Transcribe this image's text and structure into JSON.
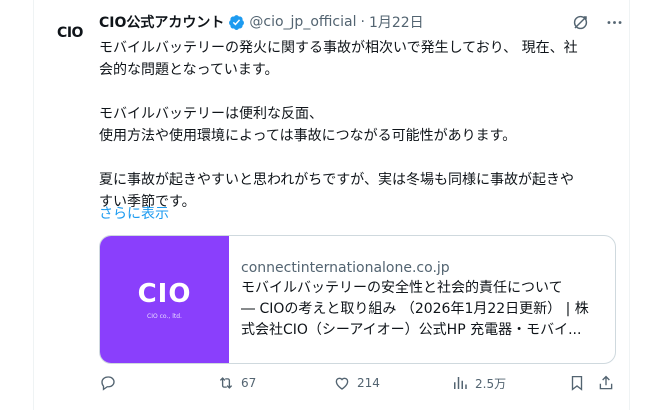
{
  "account": {
    "name": "CIO公式アカウント",
    "handle": "@cio_jp_official",
    "separator": "·",
    "date": "1月22日",
    "avatar_logo": "CIO"
  },
  "post": {
    "lines_1": [
      "モバイルバッテリーの発火に関する事故が相次いで発生しており、 現在、社",
      "会的な問題となっています。"
    ],
    "lines_2": [
      "モバイルバッテリーは便利な反面、",
      "使用方法や使用環境によっては事故につながる可能性があります。"
    ],
    "lines_3": [
      "夏に事故が起きやすいと思われがちですが、実は冬場も同様に事故が起きや",
      "すい季節です。"
    ],
    "show_more": "さらに表示"
  },
  "card": {
    "thumb_logo": "CIO",
    "thumb_sub": "CIO co., ltd.",
    "domain": "connectinternationalone.co.jp",
    "title_lines": [
      "モバイルバッテリーの安全性と社会的責任について",
      "― CIOの考えと取り組み （2026年1月22日更新） | 株",
      "式会社CIO（シーアイオー）公式HP 充電器・モバイ..."
    ]
  },
  "actions": {
    "reply_count": "",
    "retweet_count": "67",
    "like_count": "214",
    "views_count": "2.5万"
  },
  "colors": {
    "accent": "#1d9bf0",
    "card_thumb": "#8a3ffc",
    "muted": "#536471",
    "text": "#0f1419"
  },
  "icons": {
    "verified": "verified-badge-icon",
    "grok": "grok-icon",
    "more": "more-icon",
    "reply": "reply-icon",
    "retweet": "retweet-icon",
    "like": "like-icon",
    "views": "views-icon",
    "bookmark": "bookmark-icon",
    "share": "share-icon"
  }
}
